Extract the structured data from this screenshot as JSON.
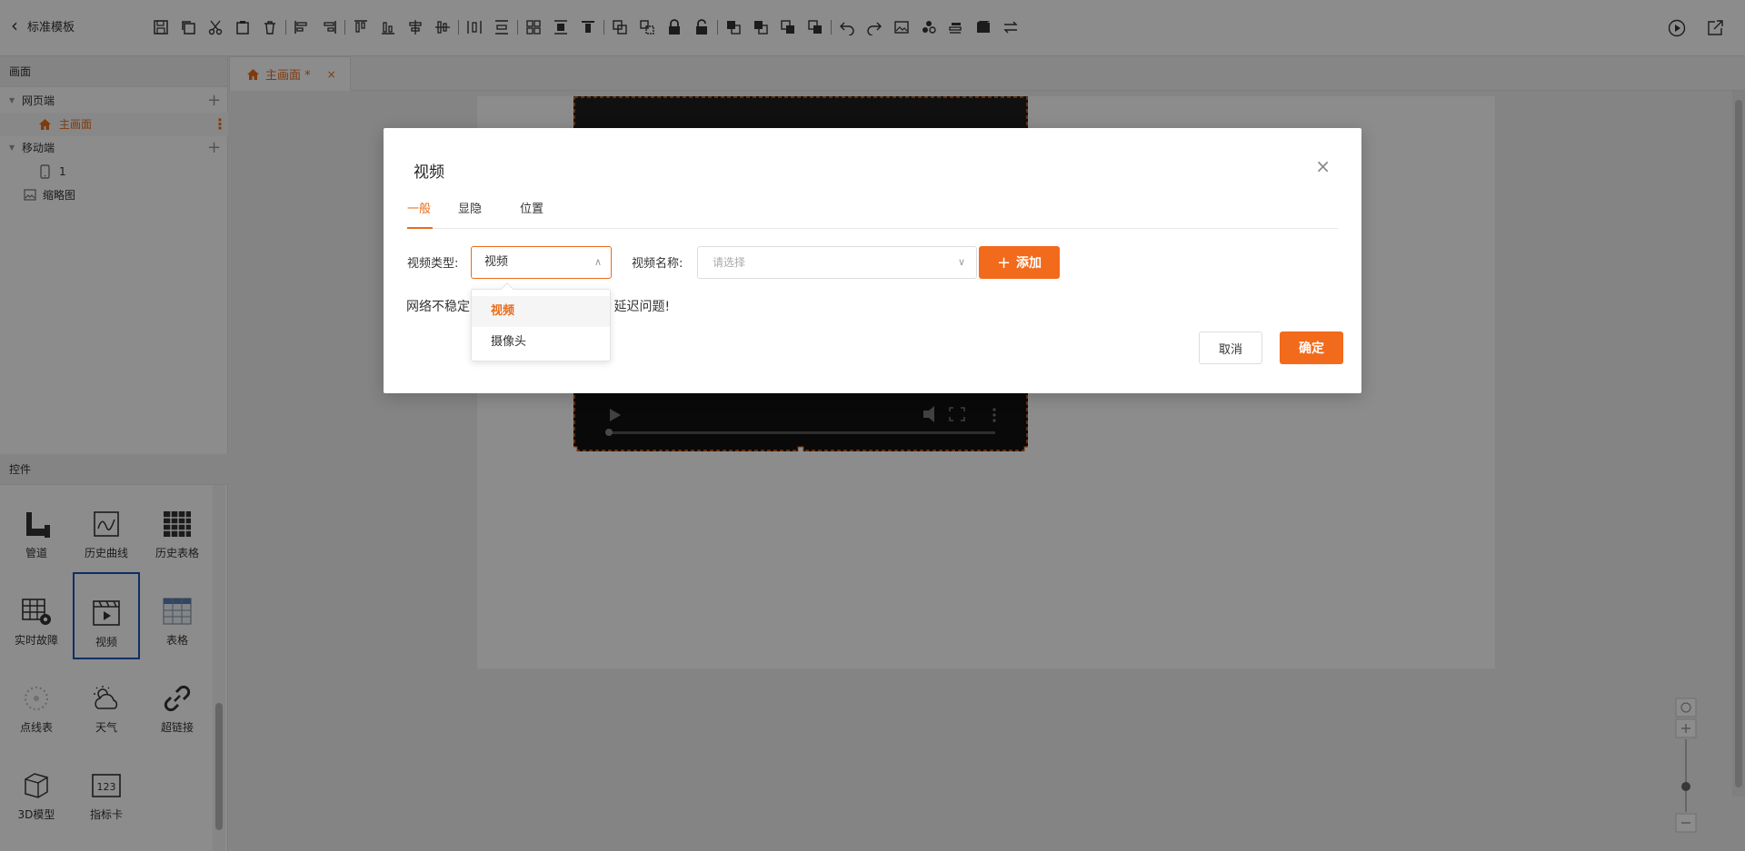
{
  "colors": {
    "accent": "#f26a1b",
    "active_text": "#e86c1b",
    "selected_border": "#1a56b8"
  },
  "toolbar": {
    "back_label": "标准模板"
  },
  "left_panel": {
    "canvas_header": "画面",
    "tree": {
      "web": "网页端",
      "main_screen": "主画面",
      "mobile": "移动端",
      "mobile_page": "1",
      "thumbnail": "缩略图"
    },
    "controls_header": "控件",
    "controls": [
      {
        "label": "管道",
        "icon": "pipe-icon"
      },
      {
        "label": "历史曲线",
        "icon": "history-curve-icon"
      },
      {
        "label": "历史表格",
        "icon": "history-table-icon"
      },
      {
        "label": "实时故障",
        "icon": "realtime-fault-icon"
      },
      {
        "label": "视频",
        "icon": "video-icon"
      },
      {
        "label": "表格",
        "icon": "table-icon"
      },
      {
        "label": "点线表",
        "icon": "dotline-icon"
      },
      {
        "label": "天气",
        "icon": "weather-icon"
      },
      {
        "label": "超链接",
        "icon": "link-icon"
      },
      {
        "label": "3D模型",
        "icon": "cube-icon"
      },
      {
        "label": "指标卡",
        "icon": "indicator-card-icon"
      }
    ]
  },
  "tabs": {
    "main_tab": "主画面 *",
    "close": "×"
  },
  "dialog": {
    "title": "视频",
    "close": "×",
    "tabs": [
      "一般",
      "显隐",
      "位置"
    ],
    "type_label": "视频类型:",
    "type_value": "视频",
    "name_label": "视频名称:",
    "name_placeholder": "请选择",
    "add_label": "添加",
    "notice_start": "网络不稳定",
    "notice_end": "延迟问题!",
    "cancel": "取消",
    "ok": "确定",
    "dropdown_options": [
      "视频",
      "摄像头"
    ]
  }
}
